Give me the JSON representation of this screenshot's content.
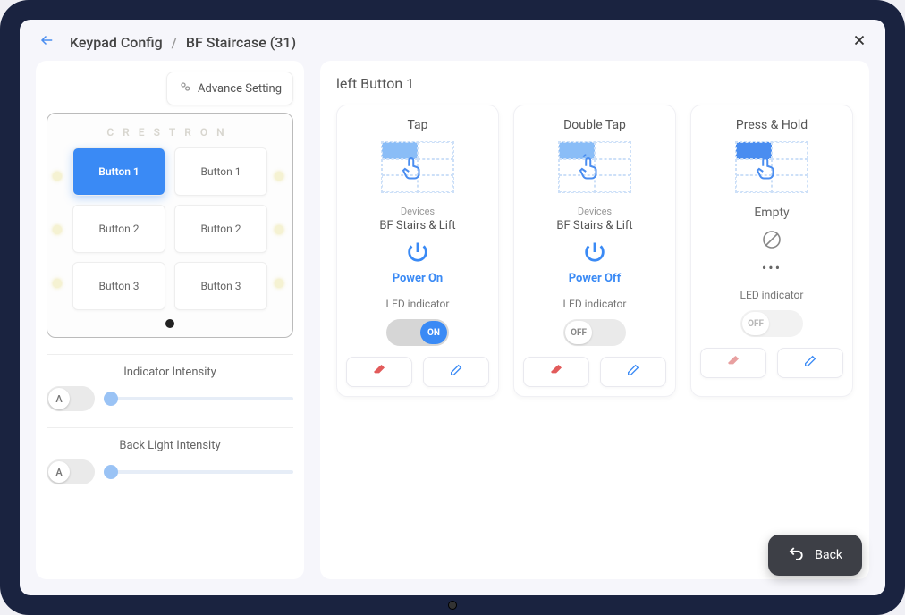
{
  "header": {
    "breadcrumb_root": "Keypad Config",
    "breadcrumb_leaf": "BF Staircase (31)"
  },
  "left": {
    "advance_label": "Advance Setting",
    "brand": "CRESTRON",
    "buttons": [
      {
        "label": "Button  1",
        "active": true
      },
      {
        "label": "Button  1",
        "active": false
      },
      {
        "label": "Button  2",
        "active": false
      },
      {
        "label": "Button  2",
        "active": false
      },
      {
        "label": "Button  3",
        "active": false
      },
      {
        "label": "Button  3",
        "active": false
      }
    ],
    "auto_badge": "A",
    "indicator_title": "Indicator Intensity",
    "backlight_title": "Back Light Intensity"
  },
  "right": {
    "title": "left Button  1",
    "cards": [
      {
        "title": "Tap",
        "devices_label": "Devices",
        "device_name": "BF Stairs & Lift",
        "action_text": "Power On",
        "led_label": "LED indicator",
        "toggle_state": "ON",
        "toggle_on": true,
        "empty": false
      },
      {
        "title": "Double Tap",
        "devices_label": "Devices",
        "device_name": "BF Stairs & Lift",
        "action_text": "Power Off",
        "led_label": "LED indicator",
        "toggle_state": "OFF",
        "toggle_on": false,
        "empty": false
      },
      {
        "title": "Press & Hold",
        "empty_text": "Empty",
        "led_label": "LED indicator",
        "toggle_state": "OFF",
        "toggle_on": false,
        "empty": true
      }
    ]
  },
  "footer": {
    "back_label": "Back"
  }
}
